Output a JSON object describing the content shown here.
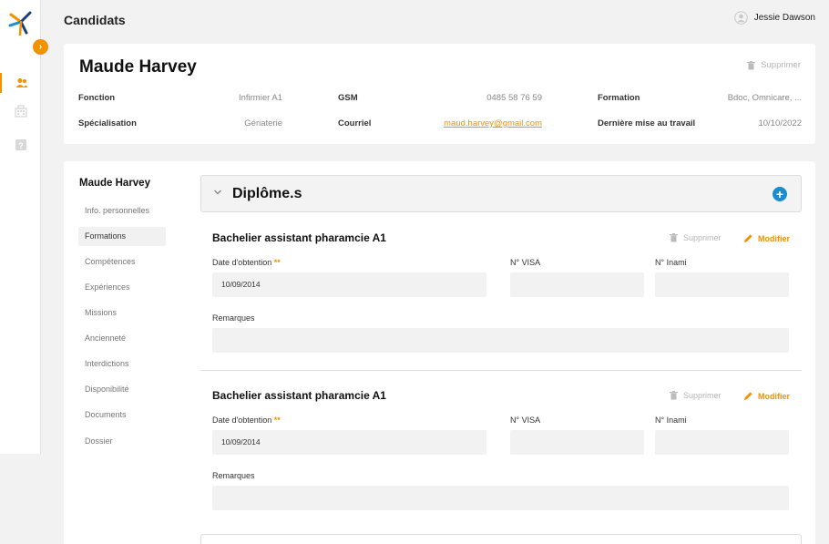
{
  "app": {
    "page_title": "Candidats",
    "user_name": "Jessie Dawson"
  },
  "colors": {
    "accent": "#f39200",
    "add_button": "#1a8ccf",
    "logo_blue": "#1f3d7a"
  },
  "nav_icons": [
    "users-icon",
    "building-icon",
    "help-icon"
  ],
  "candidate": {
    "name": "Maude Harvey",
    "delete_label": "Supprimer",
    "fields": [
      {
        "label": "Fonction",
        "value": "Infirmier A1"
      },
      {
        "label": "GSM",
        "value": "0485 58 76 59"
      },
      {
        "label": "Formation",
        "value": "Bdoc, Omnicare, ..."
      },
      {
        "label": "Spécialisation",
        "value": "Gériaterie"
      },
      {
        "label": "Courriel",
        "value": "maud.harvey@gmail.com"
      },
      {
        "label": "Dernière mise au travail",
        "value": "10/10/2022"
      }
    ]
  },
  "side_nav": {
    "title": "Maude Harvey",
    "items": [
      "Info. personnelles",
      "Formations",
      "Compétences",
      "Expériences",
      "Missions",
      "Ancienneté",
      "Interdictions",
      "Disponibilité",
      "Documents",
      "Dossier"
    ],
    "active_item": "Formations"
  },
  "section": {
    "title": "Diplôme.s"
  },
  "diplomas": [
    {
      "title": "Bachelier assistant pharamcie A1",
      "delete_label": "Supprimer",
      "edit_label": "Modifier",
      "date_label": "Date d'obtention",
      "required_mark": "**",
      "date_value": "10/09/2014",
      "visa_label": "N° VISA",
      "visa_value": "",
      "inami_label": "N° Inami",
      "inami_value": "",
      "remarks_label": "Remarques",
      "remarks_value": ""
    },
    {
      "title": "Bachelier assistant pharamcie A1",
      "delete_label": "Supprimer",
      "edit_label": "Modifier",
      "date_label": "Date d'obtention",
      "required_mark": "**",
      "date_value": "10/09/2014",
      "visa_label": "N° VISA",
      "visa_value": "",
      "inami_label": "N° Inami",
      "inami_value": "",
      "remarks_label": "Remarques",
      "remarks_value": ""
    }
  ]
}
